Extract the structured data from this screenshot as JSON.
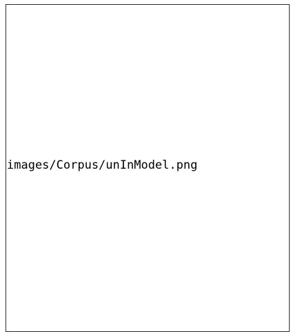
{
  "image_placeholder": {
    "text": "images/Corpus/unInModel.png"
  }
}
